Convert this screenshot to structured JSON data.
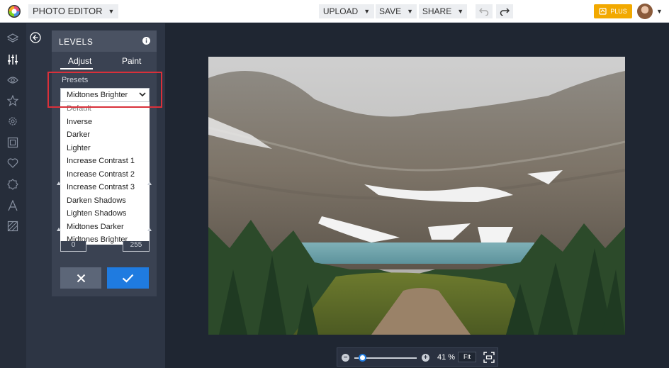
{
  "topbar": {
    "app_menu_label": "PHOTO EDITOR",
    "upload_label": "UPLOAD",
    "save_label": "SAVE",
    "share_label": "SHARE",
    "plus_label": "PLUS"
  },
  "rail_icons": [
    "layers-icon",
    "sliders-icon",
    "eye-icon",
    "star-icon",
    "gear-icon",
    "frame-icon",
    "heart-icon",
    "badge-icon",
    "text-icon",
    "texture-icon"
  ],
  "panel": {
    "title": "LEVELS",
    "tabs": [
      "Adjust",
      "Paint"
    ],
    "active_tab": "Adjust",
    "presets_label": "Presets",
    "presets_selected": "Midtones Brighter",
    "presets_options": [
      "Default",
      "Inverse",
      "Darker",
      "Lighter",
      "Increase Contrast 1",
      "Increase Contrast 2",
      "Increase Contrast 3",
      "Darken Shadows",
      "Lighten Shadows",
      "Midtones Darker",
      "Midtones Brighter"
    ],
    "output_min": "0",
    "output_max": "255"
  },
  "zoom": {
    "percent": "41 %",
    "fit_label": "Fit",
    "level": 0.41
  },
  "colors": {
    "accent_blue": "#1f7be0",
    "plus_gold": "#f2a900",
    "highlight_red": "#d9303a"
  }
}
